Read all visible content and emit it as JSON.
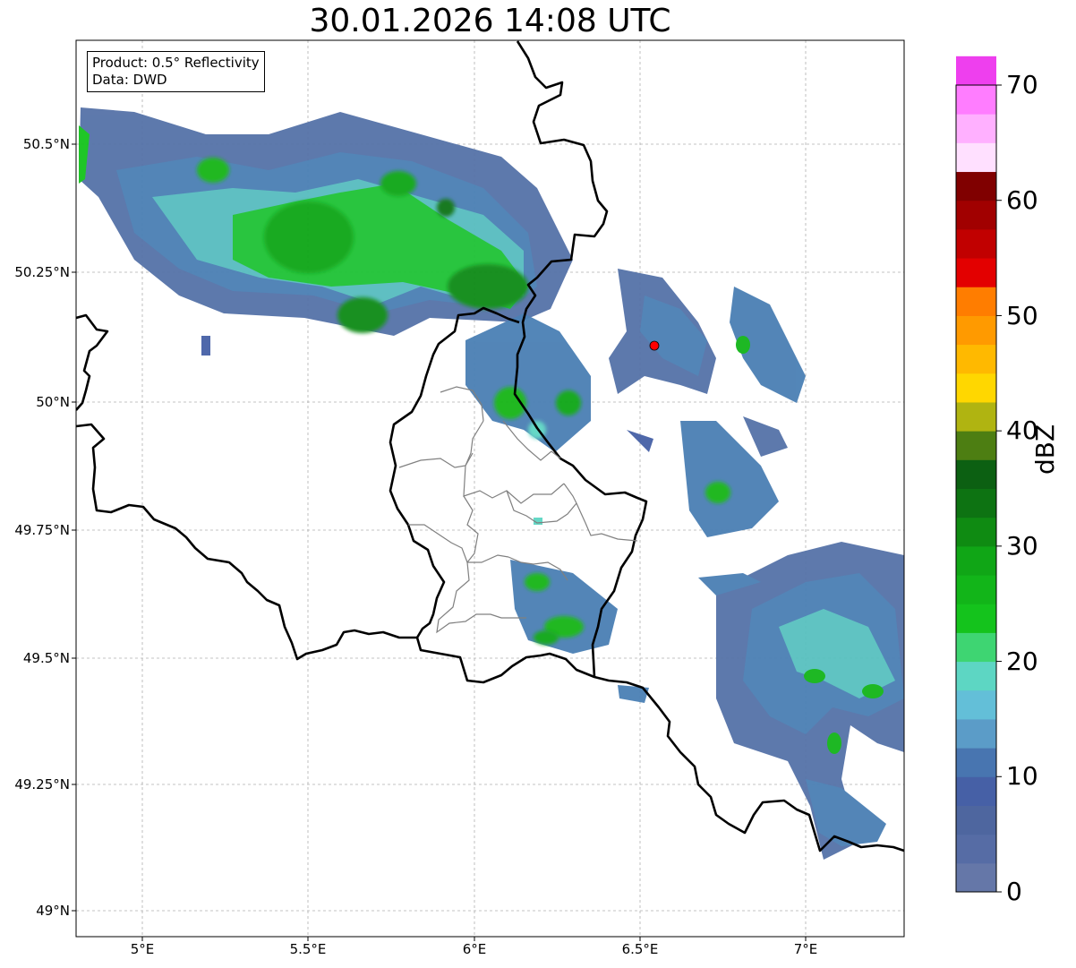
{
  "title": "30.01.2026 14:08 UTC",
  "info": {
    "product": "Product: 0.5° Reflectivity",
    "data": "Data: DWD"
  },
  "lat_ticks": [
    {
      "value": 50.5,
      "label": "50.5°N"
    },
    {
      "value": 50.25,
      "label": "50.25°N"
    },
    {
      "value": 50.0,
      "label": "50°N"
    },
    {
      "value": 49.75,
      "label": "49.75°N"
    },
    {
      "value": 49.5,
      "label": "49.5°N"
    },
    {
      "value": 49.25,
      "label": "49.25°N"
    },
    {
      "value": 49.0,
      "label": "49°N"
    }
  ],
  "lon_ticks": [
    {
      "value": 5.0,
      "label": "5°E"
    },
    {
      "value": 5.5,
      "label": "5.5°E"
    },
    {
      "value": 6.0,
      "label": "6°E"
    },
    {
      "value": 6.5,
      "label": "6.5°E"
    },
    {
      "value": 7.0,
      "label": "7°E"
    }
  ],
  "colorbar": {
    "label": "dBZ",
    "min": 0,
    "max": 70,
    "step": 2.5,
    "ticks": [
      "0",
      "10",
      "20",
      "30",
      "40",
      "50",
      "60",
      "70"
    ],
    "colors": [
      "#6577a8",
      "#566ca5",
      "#4e669f",
      "#4660a6",
      "#4875b0",
      "#5b9cc8",
      "#63bfd8",
      "#5dd6c3",
      "#3ed572",
      "#14c31c",
      "#12b519",
      "#10a616",
      "#0f8b12",
      "#0d7312",
      "#0c6012",
      "#4d7e12",
      "#b0b411",
      "#ffd700",
      "#ffb900",
      "#ff9a00",
      "#ff7d00",
      "#e30000",
      "#c10000",
      "#a10000",
      "#800000",
      "#ffe0ff",
      "#ffb0ff",
      "#ff7dff",
      "#ee3fee"
    ]
  },
  "colors": {
    "border_country": "#000000",
    "border_region": "#808080",
    "grid": "#b0b0b0",
    "radar_site": "#ff0000"
  },
  "radar_site": {
    "lat": 50.11,
    "lon": 6.55
  }
}
